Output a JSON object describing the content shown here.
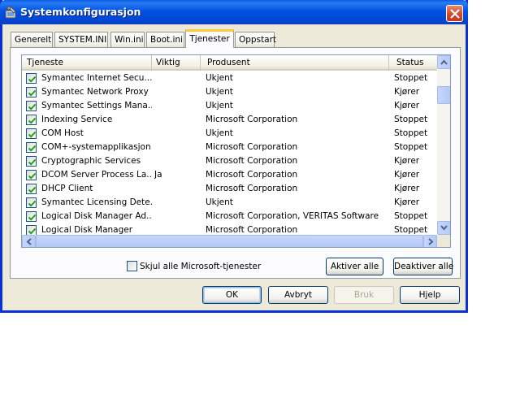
{
  "window": {
    "title": "Systemkonfigurasjon",
    "icon": "msconfig-icon"
  },
  "tabs": [
    {
      "label": "Generelt",
      "active": false
    },
    {
      "label": "SYSTEM.INI",
      "active": false
    },
    {
      "label": "Win.ini",
      "active": false
    },
    {
      "label": "Boot.ini",
      "active": false
    },
    {
      "label": "Tjenester",
      "active": true
    },
    {
      "label": "Oppstart",
      "active": false
    }
  ],
  "services_table": {
    "columns": [
      "Tjeneste",
      "Viktig",
      "Produsent",
      "Status"
    ],
    "rows": [
      {
        "checked": true,
        "name": "Symantec Internet Secu...",
        "essential": "",
        "manufacturer": "Ukjent",
        "status": "Stoppet"
      },
      {
        "checked": true,
        "name": "Symantec Network Proxy",
        "essential": "",
        "manufacturer": "Ukjent",
        "status": "Kjører"
      },
      {
        "checked": true,
        "name": "Symantec Settings Mana...",
        "essential": "",
        "manufacturer": "Ukjent",
        "status": "Kjører"
      },
      {
        "checked": true,
        "name": "Indexing Service",
        "essential": "",
        "manufacturer": "Microsoft Corporation",
        "status": "Stoppet"
      },
      {
        "checked": true,
        "name": "COM Host",
        "essential": "",
        "manufacturer": "Ukjent",
        "status": "Stoppet"
      },
      {
        "checked": true,
        "name": "COM+-systemapplikasjon",
        "essential": "",
        "manufacturer": "Microsoft Corporation",
        "status": "Stoppet"
      },
      {
        "checked": true,
        "name": "Cryptographic Services",
        "essential": "",
        "manufacturer": "Microsoft Corporation",
        "status": "Kjører"
      },
      {
        "checked": true,
        "name": "DCOM Server Process La...",
        "essential": "Ja",
        "manufacturer": "Microsoft Corporation",
        "status": "Kjører"
      },
      {
        "checked": true,
        "name": "DHCP Client",
        "essential": "",
        "manufacturer": "Microsoft Corporation",
        "status": "Kjører"
      },
      {
        "checked": true,
        "name": "Symantec Licensing Dete...",
        "essential": "",
        "manufacturer": "Ukjent",
        "status": "Kjører"
      },
      {
        "checked": true,
        "name": "Logical Disk Manager Ad...",
        "essential": "",
        "manufacturer": "Microsoft Corporation, VERITAS Software",
        "status": "Stoppet"
      },
      {
        "checked": true,
        "name": "Logical Disk Manager",
        "essential": "",
        "manufacturer": "Microsoft Corporation",
        "status": "Stoppet"
      }
    ]
  },
  "options": {
    "hide_ms_services_label": "Skjul alle Microsoft-tjenester",
    "hide_ms_services_checked": false
  },
  "buttons": {
    "enable_all": "Aktiver alle",
    "disable_all": "Deaktiver alle",
    "ok": "OK",
    "cancel": "Avbryt",
    "apply": "Bruk",
    "help": "Hjelp"
  },
  "colors": {
    "titlebar": "#0054e3",
    "window_face": "#ece9d8",
    "active_tab_accent": "#ffc83c",
    "checkmark": "#21a121"
  }
}
